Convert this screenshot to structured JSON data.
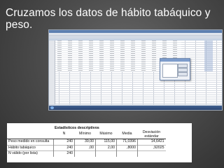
{
  "slide": {
    "title": "Cruzamos los datos de hábito tabáquico y peso."
  },
  "stats_table": {
    "caption": "Estadísticos descriptivos",
    "columns": [
      "",
      "N",
      "Mínimo",
      "Máximo",
      "Media",
      "Desviación estándar"
    ],
    "rows": [
      {
        "label": "Peso medido en consulta",
        "n": "240",
        "min": "39,00",
        "max": "115,00",
        "mean": "71,0396",
        "sd": "14,6421"
      },
      {
        "label": "Hábito tabáquico",
        "n": "240",
        "min": ",00",
        "max": "2,00",
        "mean": ",8000",
        "sd": ",92025"
      },
      {
        "label": "N válido (por lista)",
        "n": "240",
        "min": "",
        "max": "",
        "mean": "",
        "sd": ""
      }
    ]
  }
}
